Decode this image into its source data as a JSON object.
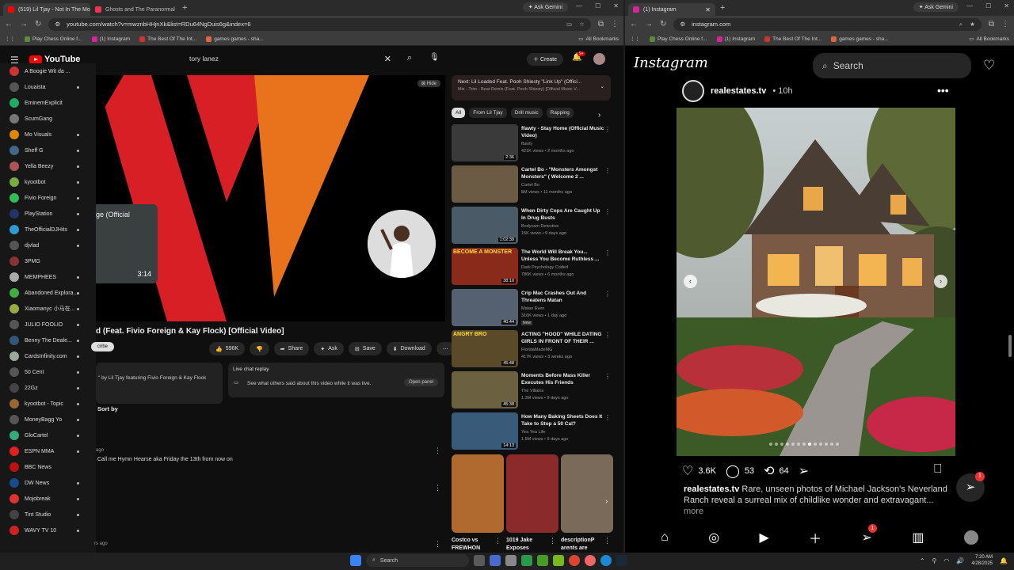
{
  "left_browser": {
    "tabs": [
      {
        "title": "(519) Lil Tjay - Not In The Mood",
        "active": true,
        "fav_color": "#ff0000"
      },
      {
        "title": "Ghosts and The Paranormal",
        "active": false,
        "fav_color": "#e35"
      }
    ],
    "ask_gemini": "Ask Gemini",
    "url": "youtube.com/watch?v=mwznbHHjnXk&list=RDu64NgDuis6g&index=6",
    "bookmarks": [
      "Play Chess Online f...",
      "(1) Instagram",
      "The Best Of The Int...",
      "games games - sha..."
    ],
    "all_bookmarks": "All Bookmarks"
  },
  "youtube": {
    "logo": "YouTube",
    "search_value": "tory lanez",
    "create_label": "Create",
    "notif_count": "9+",
    "sidebar": [
      "A Boogie Wit da ...",
      "Louaista",
      "EminemExplicit",
      "ScumGang",
      "Mo Visuals",
      "Sheff G",
      "Yella Beezy",
      "kyootbot",
      "Fivio Foreign",
      "PlayStation",
      "TheOfficialDJHits",
      "djvlad",
      "3PMG",
      "MEMPHEES",
      "Abandoned Explora...",
      "Xiaomanyc 小马在...",
      "JULIO FOOLIO",
      "Benny The Deale...",
      "CardsInfinity.com",
      "50 Cent",
      "22Gz",
      "kyootbot - Topic",
      "MoneyBagg Yo",
      "GloCartel",
      "ESPN MMA",
      "BBC News",
      "DW News",
      "Mojobreak",
      "Tint Studio",
      "WAVY TV 10"
    ],
    "hide_label": "Hide",
    "mini_title": "ge (Official",
    "mini_duration": "3:14",
    "video_title": "d (Feat. Fivio Foreign & Kay Flock) [Official Video]",
    "subscribe_label": "cribe",
    "like_count": "596K",
    "share_label": "Share",
    "ask_label": "Ask",
    "save_label": "Save",
    "download_label": "Download",
    "description": "\" by Lil Tjay featuring Fivio Foreign & Kay Flock",
    "live_chat_title": "Live chat replay",
    "live_chat_msg": "See what others said about this video while it was live.",
    "open_panel": "Open panel",
    "sort_by": "Sort by",
    "comment_time": "ago",
    "comment_text": "Call me Hymn Hearse aka Friday the 13th from now on",
    "comment_time2": "rs ago",
    "next_label": "Next: Lil Loaded Feat. Pooh Shiesty \"Link Up\" (Offici...",
    "next_sub": "Mix - Trim - Beat Remix (Feat. Pooh Shiesty) [Official Music V...",
    "chips": [
      "All",
      "From Lil Tjay",
      "Drill music",
      "Rapping"
    ],
    "recs": [
      {
        "title": "ffawty - Stay Home (Official Music Video)",
        "channel": "ffawty",
        "meta": "421K views • 2 months ago",
        "dur": "2:36",
        "color": "#3a3a3a"
      },
      {
        "title": "Cartel Bo - \"Monsters Amongst Monsters\" ( Welcome 2 ...",
        "channel": "Cartel Bo",
        "meta": "5M views • 11 months ago",
        "dur": "",
        "color": "#6b5a44"
      },
      {
        "title": "When Dirty Cops Are Caught Up In Drug Busts",
        "channel": "Bodycam Detective",
        "meta": "15K views • 9 days ago",
        "dur": "1:02:39",
        "color": "#4a5a66"
      },
      {
        "title": "The World Will Break You... Unless You Become Ruthless ...",
        "channel": "Dark Psychology Coded",
        "meta": "786K views • 6 months ago",
        "dur": "38:10",
        "color": "#8a2a1a",
        "overlay": "BECOME A MONSTER"
      },
      {
        "title": "Crip Mac Crashes Out And Threatens Matan",
        "channel": "Matan Even",
        "meta": "316K views • 1 day ago",
        "dur": "40:44",
        "color": "#556070",
        "new": "New"
      },
      {
        "title": "ACTING \"HOOD\" WHILE DATING GIRLS IN FRONT OF THEIR ...",
        "channel": "FloridaMadeMG",
        "meta": "417K views • 3 weeks ago",
        "dur": "45:48",
        "color": "#5a4a2a",
        "overlay": "ANGRY BRO"
      },
      {
        "title": "Moments Before Mass Killer Executes His Friends",
        "channel": "The Villains",
        "meta": "1.3M views • 9 days ago",
        "dur": "45:38",
        "color": "#6b6040"
      },
      {
        "title": "How Many Baking Sheets Does It Take to Stop a 50 Cal?",
        "channel": "Yea Yea Life",
        "meta": "1.5M views • 9 days ago",
        "dur": "14:13",
        "color": "#3a5a7a"
      }
    ],
    "shorts": [
      {
        "title": "Costco vs FREWHON",
        "color": "#b06a30"
      },
      {
        "title": "1019 Jake Exposes",
        "color": "#8a2a2a"
      },
      {
        "title": "descriptionP arents are",
        "color": "#7a6a5a"
      }
    ]
  },
  "right_browser": {
    "tab_title": "(1) Instagram",
    "ask_gemini": "Ask Gemini",
    "url": "instagram.com",
    "bookmarks": [
      "Play Chess Online f...",
      "(1) Instagram",
      "The Best Of The Int...",
      "games games - sha..."
    ],
    "all_bookmarks": "All Bookmarks"
  },
  "instagram": {
    "logo": "Instagram",
    "search_placeholder": "Search",
    "username": "realestates.tv",
    "time": "• 10h",
    "likes": "3.6K",
    "comments": "53",
    "reposts": "64",
    "caption_user": "realestates.tv",
    "caption": "Rare, unseen photos of Michael Jackson's Neverland Ranch reveal a surreal mix of childlike wonder and extravagant...",
    "more": "more",
    "fab_badge": "1",
    "nav_badge": "1",
    "carousel_count": 13,
    "carousel_active": 8
  },
  "taskbar": {
    "search": "Search",
    "time": "7:20 AM",
    "date": "4/28/2025"
  }
}
